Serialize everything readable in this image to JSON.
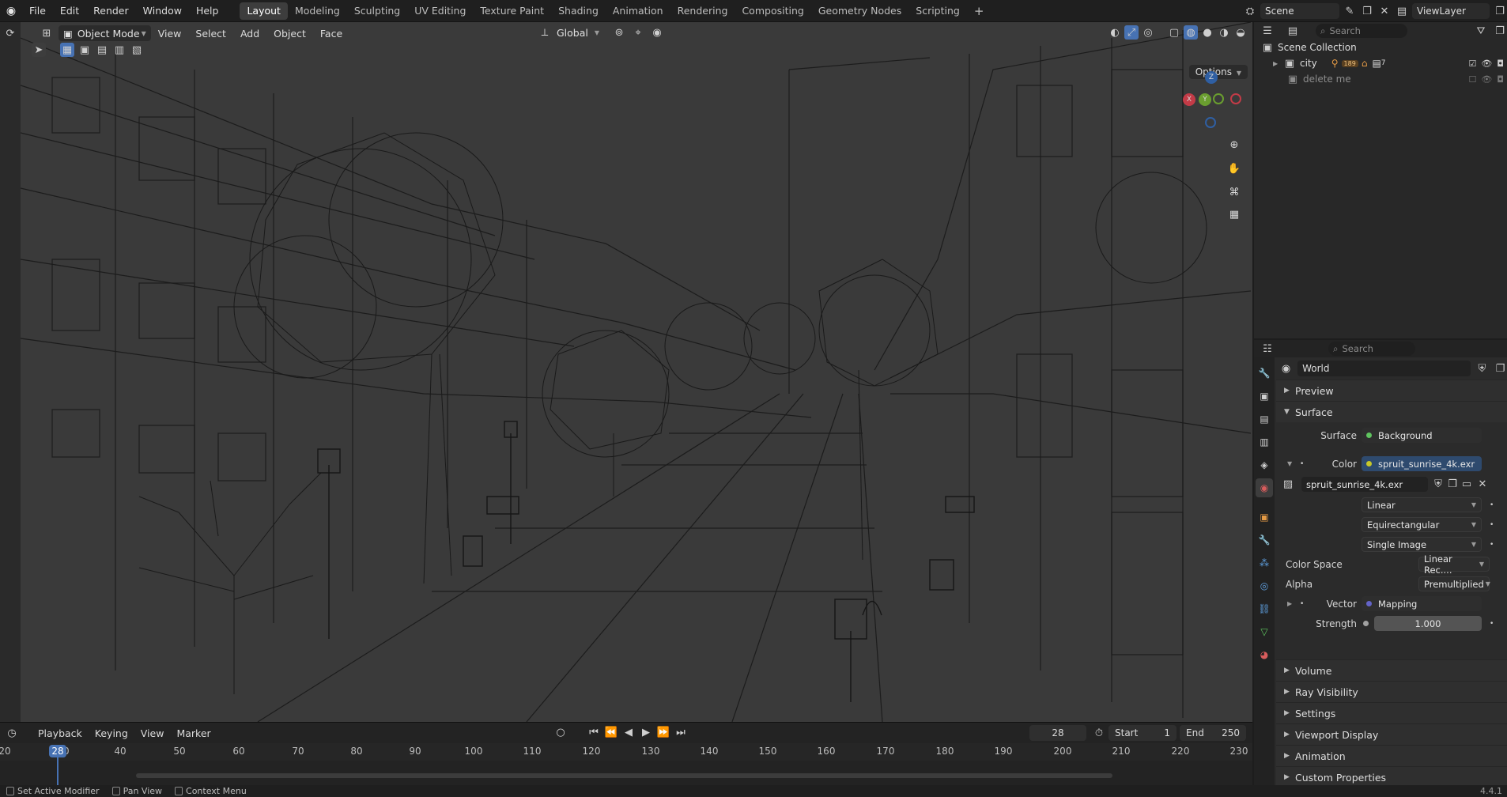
{
  "topbar": {
    "menus": [
      "File",
      "Edit",
      "Render",
      "Window",
      "Help"
    ],
    "workspaces": [
      "Layout",
      "Modeling",
      "Sculpting",
      "UV Editing",
      "Texture Paint",
      "Shading",
      "Animation",
      "Rendering",
      "Compositing",
      "Geometry Nodes",
      "Scripting"
    ],
    "active_workspace": "Layout",
    "add_tab": "+",
    "scene_name": "Scene",
    "view_layer": "ViewLayer"
  },
  "viewport": {
    "mode": "Object Mode",
    "menus": [
      "View",
      "Select",
      "Add",
      "Object",
      "Face"
    ],
    "transform_orientation": "Global",
    "options_label": "Options",
    "gizmo_axes": {
      "x": "X",
      "y": "Y",
      "z": "Z"
    }
  },
  "timeline": {
    "menus": [
      "Playback",
      "Keying",
      "View",
      "Marker"
    ],
    "current_frame": "28",
    "start_label": "Start",
    "start_value": "1",
    "end_label": "End",
    "end_value": "250",
    "ruler_ticks": [
      "20",
      "40",
      "50",
      "60",
      "70",
      "80",
      "90",
      "100",
      "110",
      "120",
      "130",
      "140",
      "150",
      "160",
      "170",
      "180",
      "190",
      "200",
      "210",
      "220",
      "230"
    ],
    "playhead_label": "28",
    "playhead_suffix": "30"
  },
  "statusbar": {
    "items": [
      "Set Active Modifier",
      "Pan View",
      "Context Menu"
    ],
    "version": "4.4.1"
  },
  "outliner": {
    "search_placeholder": "Search",
    "collection_root": "Scene Collection",
    "rows": [
      {
        "name": "city",
        "count_a": "189",
        "count_b": "7"
      },
      {
        "name": "delete me"
      }
    ]
  },
  "properties": {
    "search_placeholder": "Search",
    "world_name": "World",
    "panels_top": [
      "Preview",
      "Surface"
    ],
    "surface": {
      "surface_label": "Surface",
      "surface_value": "Background",
      "color_label": "Color",
      "color_value": "spruit_sunrise_4k.exr",
      "image_name": "spruit_sunrise_4k.exr",
      "interpolation": "Linear",
      "projection": "Equirectangular",
      "source": "Single Image",
      "color_space_label": "Color Space",
      "color_space_value": "Linear Rec....",
      "alpha_label": "Alpha",
      "alpha_value": "Premultiplied",
      "vector_label": "Vector",
      "vector_value": "Mapping",
      "strength_label": "Strength",
      "strength_value": "1.000"
    },
    "panels_bottom": [
      "Volume",
      "Ray Visibility",
      "Settings",
      "Viewport Display",
      "Animation",
      "Custom Properties"
    ],
    "colors": {
      "socket_yellow": "#c7c729",
      "socket_purple": "#6363c7",
      "socket_gray": "#a1a1a1",
      "accent": "#4772b3"
    }
  }
}
